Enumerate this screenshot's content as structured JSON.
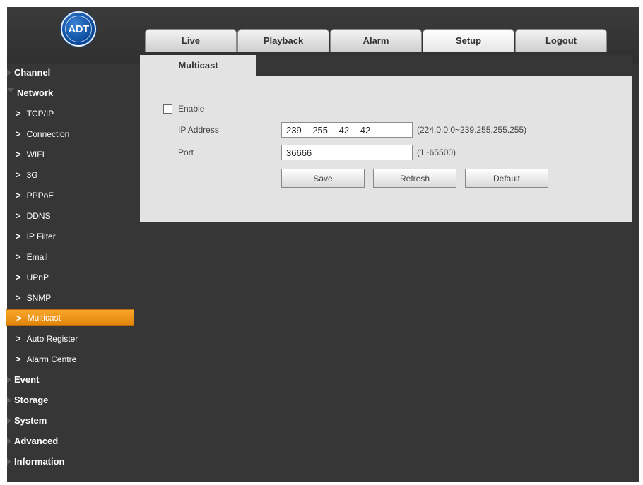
{
  "brand": {
    "logo_text": "ADT"
  },
  "top_tabs": [
    {
      "label": "Live"
    },
    {
      "label": "Playback"
    },
    {
      "label": "Alarm"
    },
    {
      "label": "Setup",
      "active": true
    },
    {
      "label": "Logout"
    }
  ],
  "sidebar": {
    "categories": [
      {
        "label": "Channel"
      },
      {
        "label": "Network"
      },
      {
        "label": "Event"
      },
      {
        "label": "Storage"
      },
      {
        "label": "System"
      },
      {
        "label": "Advanced"
      },
      {
        "label": "Information"
      }
    ],
    "network_items": [
      {
        "label": "TCP/IP"
      },
      {
        "label": "Connection"
      },
      {
        "label": "WIFI"
      },
      {
        "label": "3G"
      },
      {
        "label": "PPPoE"
      },
      {
        "label": "DDNS"
      },
      {
        "label": "IP Filter"
      },
      {
        "label": "Email"
      },
      {
        "label": "UPnP"
      },
      {
        "label": "SNMP"
      },
      {
        "label": "Multicast",
        "active": true
      },
      {
        "label": "Auto Register"
      },
      {
        "label": "Alarm Centre"
      }
    ]
  },
  "content": {
    "tab_label": "Multicast",
    "enable_label": "Enable",
    "enable_checked": false,
    "ip_label": "IP Address",
    "ip_octets": [
      "239",
      "255",
      "42",
      "42"
    ],
    "ip_hint": "(224.0.0.0~239.255.255.255)",
    "port_label": "Port",
    "port_value": "36666",
    "port_hint": "(1~65500)",
    "buttons": {
      "save": "Save",
      "refresh": "Refresh",
      "default": "Default"
    }
  },
  "colors": {
    "active_item": "#f39a1c",
    "background": "#363636",
    "panel": "#e3e3e3"
  }
}
